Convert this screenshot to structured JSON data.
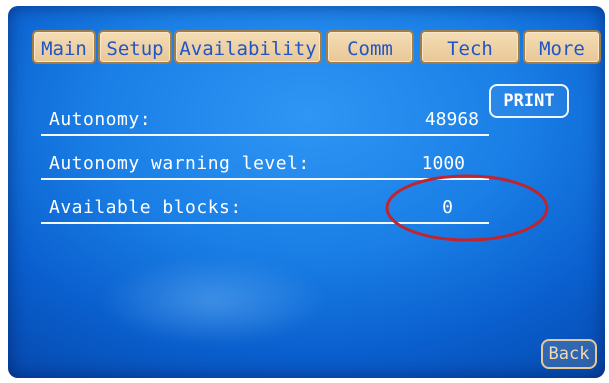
{
  "tabs": [
    {
      "label": "Main"
    },
    {
      "label": "Setup"
    },
    {
      "label": "Availability"
    },
    {
      "label": "Comm"
    },
    {
      "label": "Tech"
    },
    {
      "label": "More"
    }
  ],
  "rows": [
    {
      "label": "Autonomy:",
      "value": "48968"
    },
    {
      "label": "Autonomy warning level:",
      "value": "1000"
    },
    {
      "label": "Available blocks:",
      "value": "0"
    }
  ],
  "buttons": {
    "print_label": "PRINT",
    "back_label": "Back"
  },
  "colors": {
    "screen_blue": "#1a7fe6",
    "tab_fill": "#e8c796",
    "tab_text": "#1f55c8",
    "annotation_circle": "#c0242f"
  }
}
